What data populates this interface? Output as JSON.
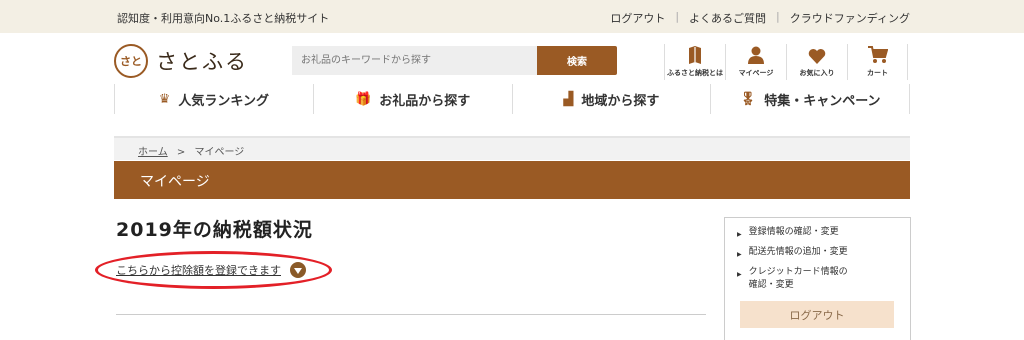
{
  "topbar": {
    "tagline": "認知度・利用意向No.1ふるさと納税サイト",
    "links": [
      "ログアウト",
      "よくあるご質問",
      "クラウドファンディング"
    ],
    "separator": "|"
  },
  "logo": {
    "mark": "さと",
    "text": "さとふる"
  },
  "search": {
    "placeholder": "お礼品のキーワードから探す",
    "button": "検索"
  },
  "header_icons": [
    {
      "icon": "book-icon",
      "label": "ふるさと納税とは"
    },
    {
      "icon": "person-icon",
      "label": "マイページ"
    },
    {
      "icon": "heart-icon",
      "label": "お気に入り"
    },
    {
      "icon": "cart-icon",
      "label": "カート"
    }
  ],
  "gnav": [
    {
      "icon": "crown-icon",
      "glyph": "♛",
      "label": "人気ランキング"
    },
    {
      "icon": "gift-icon",
      "glyph": "🎁",
      "label": "お礼品から探す"
    },
    {
      "icon": "map-icon",
      "glyph": "▟",
      "label": "地域から探す"
    },
    {
      "icon": "medal-icon",
      "glyph": "🎖",
      "label": "特集・キャンペーン"
    }
  ],
  "breadcrumb": {
    "home": "ホーム",
    "sep": ">",
    "current": "マイページ"
  },
  "page_heading": "マイページ",
  "main": {
    "title": "2019年の納税額状況",
    "deduction_link": "こちらから控除額を登録できます"
  },
  "side_menu": {
    "items": [
      "登録情報の確認・変更",
      "配送先情報の追加・変更",
      "クレジットカード情報の",
      "確認・変更"
    ],
    "logout": "ログアウト"
  },
  "colors": {
    "brand": "#9a5a24",
    "highlight_oval": "#e32027",
    "topbar_bg": "#f3efe4"
  }
}
